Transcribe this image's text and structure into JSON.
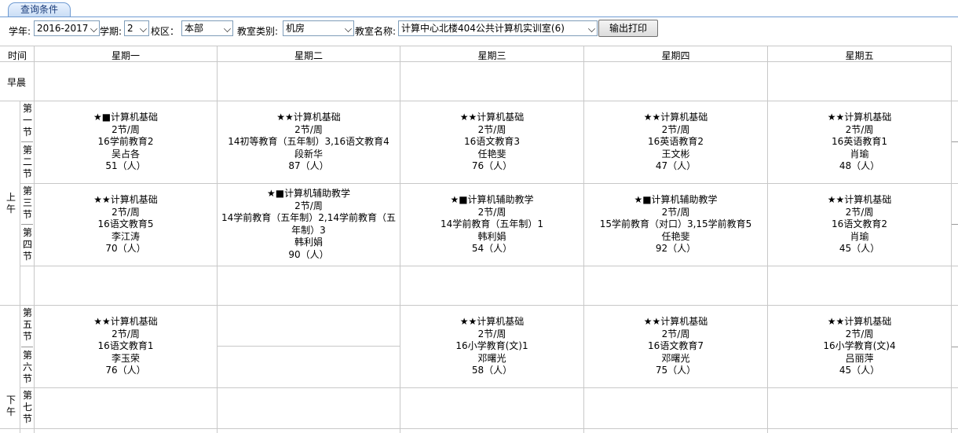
{
  "query_tab": {
    "label": "查询条件"
  },
  "filters": {
    "year_label": "学年:",
    "year_value": "2016-2017",
    "term_label": "学期:",
    "term_value": "2",
    "campus_label": "校区：",
    "campus_value": "本部",
    "room_type_label": "教室类别:",
    "room_type_value": "机房",
    "room_name_label": "教室名称:",
    "room_name_value": "计算中心北楼404公共计算机实训室(6)",
    "print_button": "输出打印"
  },
  "timetable": {
    "time_header": "时间",
    "days": [
      "星期一",
      "星期二",
      "星期三",
      "星期四",
      "星期五"
    ],
    "row_labels": {
      "morning_early": "早晨",
      "am": "上午",
      "pm": "下午",
      "p1": "第一节",
      "p2": "第二节",
      "p3": "第三节",
      "p4": "第四节",
      "p5": "第五节",
      "p6": "第六节",
      "p7": "第七节"
    },
    "blocks": [
      {
        "id": "b12_mon",
        "lines": [
          "★■计算机基础",
          "2节/周",
          "16学前教育2",
          "吴占各",
          "51（人）"
        ]
      },
      {
        "id": "b12_tue",
        "lines": [
          "★★计算机基础",
          "2节/周",
          "14初等教育（五年制）3,16语文教育4",
          "段新华",
          "87（人）"
        ]
      },
      {
        "id": "b12_wed",
        "lines": [
          "★★计算机基础",
          "2节/周",
          "16语文教育3",
          "任艳斐",
          "76（人）"
        ]
      },
      {
        "id": "b12_thu",
        "lines": [
          "★★计算机基础",
          "2节/周",
          "16英语教育2",
          "王文彬",
          "47（人）"
        ]
      },
      {
        "id": "b12_fri",
        "lines": [
          "★★计算机基础",
          "2节/周",
          "16英语教育1",
          "肖瑜",
          "48（人）"
        ]
      },
      {
        "id": "b34_mon",
        "lines": [
          "★★计算机基础",
          "2节/周",
          "16语文教育5",
          "李江涛",
          "70（人）"
        ]
      },
      {
        "id": "b34_tue",
        "lines": [
          "★■计算机辅助教学",
          "2节/周",
          "14学前教育（五年制）2,14学前教育（五年制）3",
          "韩利娟",
          "90（人）"
        ]
      },
      {
        "id": "b34_wed",
        "lines": [
          "★■计算机辅助教学",
          "2节/周",
          "14学前教育（五年制）1",
          "韩利娟",
          "54（人）"
        ]
      },
      {
        "id": "b34_thu",
        "lines": [
          "★■计算机辅助教学",
          "2节/周",
          "15学前教育（对口）3,15学前教育5",
          "任艳斐",
          "92（人）"
        ]
      },
      {
        "id": "b34_fri",
        "lines": [
          "★★计算机基础",
          "2节/周",
          "16语文教育2",
          "肖瑜",
          "45（人）"
        ]
      },
      {
        "id": "b56_mon",
        "lines": [
          "★★计算机基础",
          "2节/周",
          "16语文教育1",
          "李玉荣",
          "76（人）"
        ]
      },
      {
        "id": "b56_wed",
        "lines": [
          "★★计算机基础",
          "2节/周",
          "16小学教育(文)1",
          "邓曙光",
          "58（人）"
        ]
      },
      {
        "id": "b56_thu",
        "lines": [
          "★★计算机基础",
          "2节/周",
          "16语文教育7",
          "邓曙光",
          "75（人）"
        ]
      },
      {
        "id": "b56_fri",
        "lines": [
          "★★计算机基础",
          "2节/周",
          "16小学教育(文)4",
          "吕丽萍",
          "45（人）"
        ]
      }
    ]
  },
  "colors": {
    "tab_border": "#6f9bd2",
    "grid": "#c8c8c8",
    "tab_text": "#1a3c7a"
  }
}
